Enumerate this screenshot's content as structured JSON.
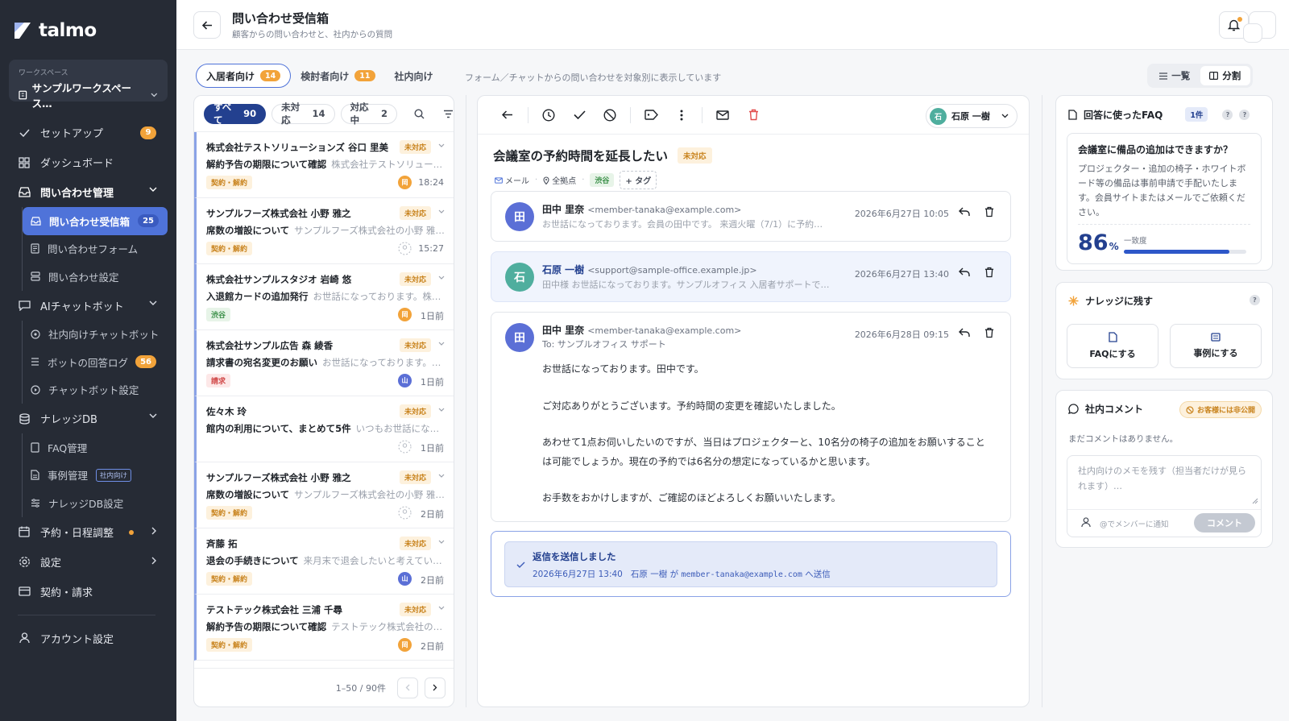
{
  "app": {
    "logo_text": "talmo"
  },
  "workspace": {
    "label": "ワークスペース",
    "name": "サンプルワークスペース…"
  },
  "nav": {
    "setup": {
      "label": "セットアップ",
      "badge": "9"
    },
    "dashboard": {
      "label": "ダッシュボード"
    },
    "inquiry": {
      "label": "問い合わせ管理",
      "items": [
        {
          "label": "問い合わせ受信箱",
          "badge": "25"
        },
        {
          "label": "問い合わせフォーム"
        },
        {
          "label": "問い合わせ設定"
        }
      ]
    },
    "chatbot": {
      "label": "AIチャットボット",
      "items": [
        {
          "label": "社内向けチャットボット"
        },
        {
          "label": "ボットの回答ログ",
          "badge": "56"
        },
        {
          "label": "チャットボット設定"
        }
      ]
    },
    "knowledge": {
      "label": "ナレッジDB",
      "items": [
        {
          "label": "FAQ管理"
        },
        {
          "label": "事例管理",
          "tag": "社内向け"
        },
        {
          "label": "ナレッジDB設定"
        }
      ]
    },
    "booking": {
      "label": "予約・日程調整"
    },
    "settings": {
      "label": "設定"
    },
    "billing": {
      "label": "契約・請求"
    },
    "account": {
      "label": "アカウント設定"
    }
  },
  "header": {
    "title": "問い合わせ受信箱",
    "subtitle": "顧客からの問い合わせと、社内からの質問",
    "user_initial": "石"
  },
  "audience_tabs": [
    {
      "label": "入居者向け",
      "count": "14"
    },
    {
      "label": "検討者向け",
      "count": "11"
    },
    {
      "label": "社内向け"
    }
  ],
  "tab_hint": "フォーム／チャットからの問い合わせを対象別に表示しています",
  "view_toggle": {
    "list": "一覧",
    "split": "分割"
  },
  "list": {
    "filters": [
      {
        "label": "すべて",
        "count": "90"
      },
      {
        "label": "未対応",
        "count": "14"
      },
      {
        "label": "対応中",
        "count": "2"
      }
    ],
    "items": [
      {
        "sender": "株式会社テストソリューションズ 谷口 里美",
        "subject": "解約予告の期限について確認",
        "preview": "株式会社テストソリュー…",
        "status": "未対応",
        "tag": "契約・解約",
        "assignee": "岡",
        "time": "18:24"
      },
      {
        "sender": "サンプルフーズ株式会社 小野 雅之",
        "subject": "席数の増設について",
        "preview": "サンプルフーズ株式会社の小野 雅…",
        "status": "未対応",
        "tag": "契約・解約",
        "assignee": "",
        "time": "15:27"
      },
      {
        "sender": "株式会社サンプルスタジオ 岩崎 悠",
        "subject": "入退館カードの追加発行",
        "preview": "お世話になっております。株…",
        "status": "未対応",
        "tag": "渋谷",
        "assignee": "岡",
        "time": "1日前"
      },
      {
        "sender": "株式会社サンプル広告 森 綾香",
        "subject": "請求書の宛名変更のお願い",
        "preview": "お世話になっております。…",
        "status": "未対応",
        "tag": "請求",
        "assignee": "山",
        "time": "1日前"
      },
      {
        "sender": "佐々木 玲",
        "subject": "館内の利用について、まとめて5件",
        "preview": "いつもお世話にな…",
        "status": "未対応",
        "tag": "",
        "assignee": "",
        "time": "1日前"
      },
      {
        "sender": "サンプルフーズ株式会社 小野 雅之",
        "subject": "席数の増設について",
        "preview": "サンプルフーズ株式会社の小野 雅…",
        "status": "未対応",
        "tag": "契約・解約",
        "assignee": "",
        "time": "2日前"
      },
      {
        "sender": "斉藤 拓",
        "subject": "退会の手続きについて",
        "preview": "来月末で退会したいと考えてい…",
        "status": "未対応",
        "tag": "契約・解約",
        "assignee": "山",
        "time": "2日前"
      },
      {
        "sender": "テストテック株式会社 三浦 千尋",
        "subject": "解約予告の期限について確認",
        "preview": "テストテック株式会社の…",
        "status": "未対応",
        "tag": "契約・解約",
        "assignee": "岡",
        "time": "2日前"
      }
    ],
    "pagination": "1–50 / 90件"
  },
  "detail": {
    "assignee": {
      "initial": "石",
      "name": "石原 一樹"
    },
    "subject": "会議室の予約時間を延長したい",
    "status": "未対応",
    "meta": {
      "channel": "メール",
      "location": "全拠点",
      "tag": "渋谷",
      "add_tag": "+ タグ"
    },
    "messages": [
      {
        "initial": "田",
        "name": "田中 里奈",
        "email": "<member-tanaka@example.com>",
        "preview": "お世話になっております。会員の田中です。 来週火曜（7/1）に予約…",
        "date": "2026年6月27日 10:05"
      },
      {
        "initial": "石",
        "name": "石原 一樹",
        "email": "<support@sample-office.example.jp>",
        "preview": "田中様 お世話になっております。サンプルオフィス 入居者サポートで…",
        "date": "2026年6月27日 13:40"
      },
      {
        "initial": "田",
        "name": "田中 里奈",
        "email": "<member-tanaka@example.com>",
        "to": "To: サンプルオフィス サポート",
        "date": "2026年6月28日 09:15",
        "body": [
          "お世話になっております。田中です。",
          "ご対応ありがとうございます。予約時間の変更を確認いたしました。",
          "あわせて1点お伺いしたいのですが、当日はプロジェクターと、10名分の椅子の追加をお願いすること",
          "は可能でしょうか。現在の予約では6名分の想定になっているかと思います。",
          "お手数をおかけしますが、ご確認のほどよろしくお願いいたします。"
        ]
      }
    ],
    "sent": {
      "title": "返信を送信しました",
      "date": "2026年6月27日 13:40",
      "who": "石原 一樹 が",
      "email": "member-tanaka@example.com",
      "suffix": "へ送信"
    }
  },
  "faq_card": {
    "title": "回答に使ったFAQ",
    "count": "1件",
    "question": "会議室に備品の追加はできますか？",
    "answer": "プロジェクター・追加の椅子・ホワイトボード等の備品は事前申請で手配いたします。会員サイトまたはメールでご依頼ください。",
    "match_value": "86",
    "match_unit": "%",
    "match_label": "一致度",
    "match_fraction": 0.86
  },
  "knowledge_card": {
    "title": "ナレッジに残す",
    "faq_btn": "FAQにする",
    "case_btn": "事例にする"
  },
  "comment_card": {
    "title": "社内コメント",
    "notice": "お客様には非公開",
    "empty": "まだコメントはありません。",
    "placeholder": "社内向けのメモを残す（担当者だけが見られます）…",
    "mention": "@でメンバーに通知",
    "send": "コメント"
  },
  "colors": {
    "sidebar_bg": "#262b35",
    "accent": "#4f73d9",
    "navy": "#23408f",
    "badge": "#f2a33a",
    "danger": "#e24b4b",
    "avatar_teal": "#4fae9e",
    "avatar_blue": "#5b6fd6"
  }
}
